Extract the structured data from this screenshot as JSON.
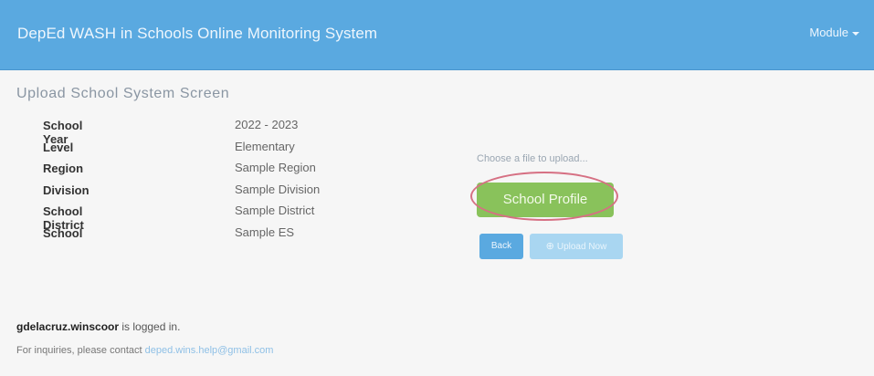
{
  "header": {
    "app_title": "DepEd WASH in Schools Online Monitoring System",
    "module_menu_label": "Module"
  },
  "main": {
    "screen_title": "Upload School System Screen",
    "fields": [
      {
        "label": "School Year",
        "value": "2022 - 2023"
      },
      {
        "label": "Level",
        "value": "Elementary"
      },
      {
        "label": "Region",
        "value": "Sample Region"
      },
      {
        "label": "Division",
        "value": "Sample Division"
      },
      {
        "label": "School District",
        "value": "Sample District"
      },
      {
        "label": "School",
        "value": "Sample ES"
      }
    ]
  },
  "upload": {
    "choose_file_text": "Choose a file to upload...",
    "school_profile_label": "School Profile",
    "back_label": "Back",
    "upload_now_label": "Upload Now",
    "highlight_color": "#d67083"
  },
  "footer": {
    "username": "gdelacruz.winscoor",
    "logged_in_suffix": " is logged in.",
    "inquiry_prefix": "For inquiries, please contact ",
    "contact_email": "deped.wins.help@gmail.com"
  },
  "colors": {
    "navbar": "#5aa9e0",
    "school_profile_button": "#89c25b",
    "back_button": "#5aa9e0",
    "upload_button": "#a9d6f1"
  }
}
